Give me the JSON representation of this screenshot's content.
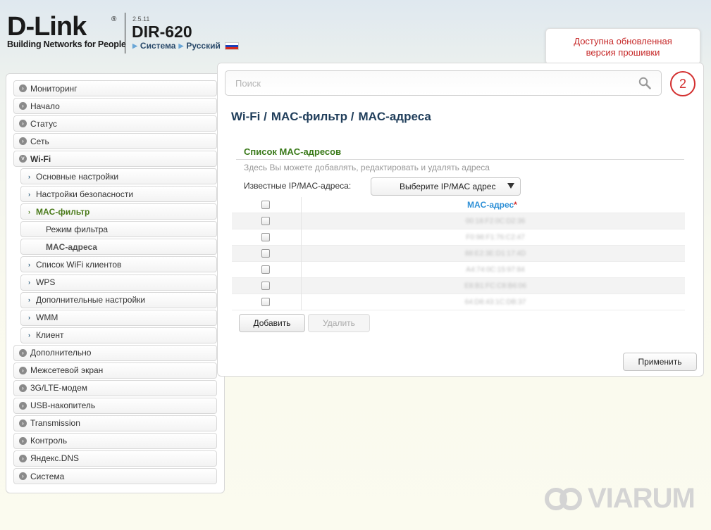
{
  "header": {
    "brand": "D-Link",
    "brand_reg": "®",
    "tagline": "Building Networks for People",
    "firmware_version": "2.5.11",
    "model": "DIR-620",
    "link_system": "Система",
    "link_language": "Русский"
  },
  "notice": {
    "line1": "Доступна обновленная",
    "line2": "версия прошивки"
  },
  "notification_count": "2",
  "search": {
    "placeholder": "Поиск",
    "value": ""
  },
  "sidebar": {
    "items": [
      {
        "label": "Мониторинг"
      },
      {
        "label": "Начало"
      },
      {
        "label": "Статус"
      },
      {
        "label": "Сеть"
      },
      {
        "label": "Wi-Fi"
      },
      {
        "label": "Основные настройки"
      },
      {
        "label": "Настройки безопасности"
      },
      {
        "label": "MAC-фильтр"
      },
      {
        "label": "Режим фильтра"
      },
      {
        "label": "MAC-адреса"
      },
      {
        "label": "Список WiFi клиентов"
      },
      {
        "label": "WPS"
      },
      {
        "label": "Дополнительные настройки"
      },
      {
        "label": "WMM"
      },
      {
        "label": "Клиент"
      },
      {
        "label": "Дополнительно"
      },
      {
        "label": "Межсетевой экран"
      },
      {
        "label": "3G/LTE-модем"
      },
      {
        "label": "USB-накопитель"
      },
      {
        "label": "Transmission"
      },
      {
        "label": "Контроль"
      },
      {
        "label": "Яндекс.DNS"
      },
      {
        "label": "Система"
      }
    ]
  },
  "breadcrumb": [
    "Wi-Fi /",
    "MAC-фильтр /",
    "MAC-адреса"
  ],
  "section": {
    "title": "Список MAC-адресов",
    "description": "Здесь Вы можете добавлять, редактировать и удалять адреса",
    "known_label": "Известные IP/MAC-адреса:",
    "select_value": "Выберите IP/MAC адрес"
  },
  "table": {
    "column_header": "MAC-адрес",
    "required_mark": "*",
    "rows": [
      {
        "mac": "00:18:F2:0C:D2:36"
      },
      {
        "mac": "F0:98:F1:76:C2:47"
      },
      {
        "mac": "88:E2:3E:D1:17:4D"
      },
      {
        "mac": "A4:74:0C:15:97:84"
      },
      {
        "mac": "E8:B1:FC:C8:B6:06"
      },
      {
        "mac": "64:D8:43:1C:DB:37"
      }
    ]
  },
  "buttons": {
    "add": "Добавить",
    "delete": "Удалить",
    "apply": "Применить"
  },
  "watermark": "VIARUM",
  "colors": {
    "accent_green": "#3a7a1a",
    "accent_blue": "#2d8fd6",
    "alert_red": "#d32f2f",
    "title_navy": "#1f3d5a"
  }
}
